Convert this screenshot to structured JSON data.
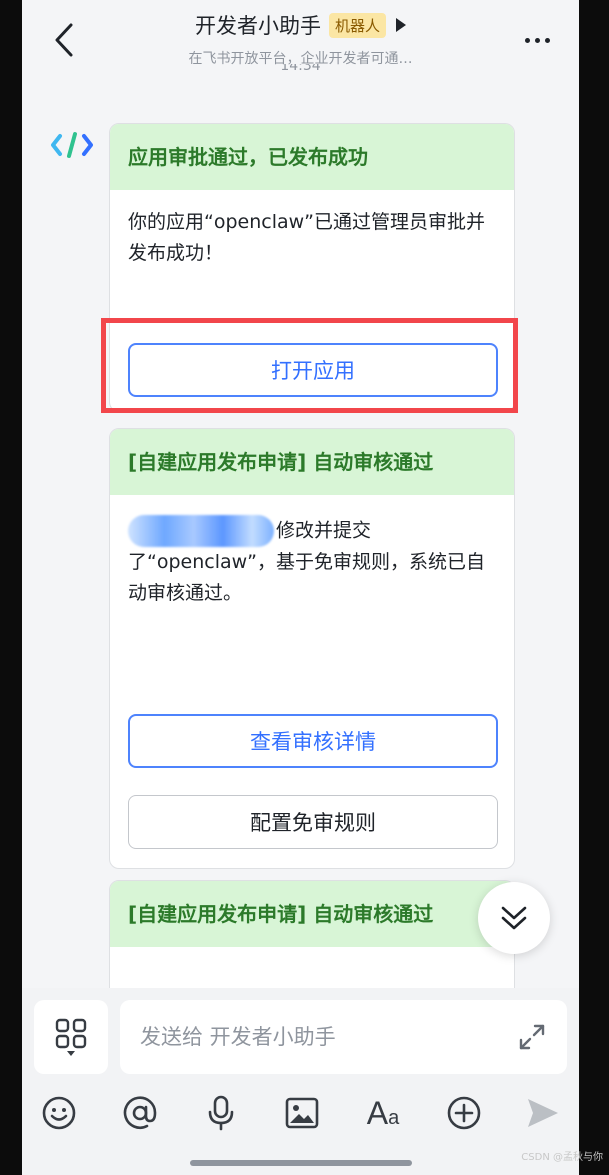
{
  "header": {
    "title": "开发者小助手",
    "tag": "机器人",
    "subtitle": "在飞书开放平台，企业开发者可通…",
    "time_partial": "14:34"
  },
  "messages": [
    {
      "title": "应用审批通过，已发布成功",
      "body": "你的应用“openclaw”已通过管理员审批并发布成功！",
      "buttons": [
        {
          "label": "打开应用"
        }
      ]
    },
    {
      "title": "[自建应用发布申请] 自动审核通过",
      "body_suffix": "修改并提交了“openclaw”，基于免审规则，系统已自动审核通过。",
      "buttons": [
        {
          "label": "查看审核详情"
        },
        {
          "label": "配置免审规则"
        }
      ]
    },
    {
      "title": "[自建应用发布申请] 自动审核通过"
    }
  ],
  "composer": {
    "placeholder": "发送给 开发者小助手"
  },
  "icons": [
    "back-icon",
    "more-icon",
    "emoji-icon",
    "mention-icon",
    "mic-icon",
    "image-icon",
    "text-format-icon",
    "add-icon",
    "send-icon",
    "expand-icon",
    "apps-icon",
    "chevron-double-down-icon"
  ],
  "watermark": "CSDN @孟秋与你",
  "colors": {
    "card_header_bg": "#d8f5d6",
    "card_header_text": "#2c7a2a",
    "primary_blue": "#3370ff",
    "highlight_red": "#f2464b",
    "tag_bg": "#fbe6a4"
  }
}
